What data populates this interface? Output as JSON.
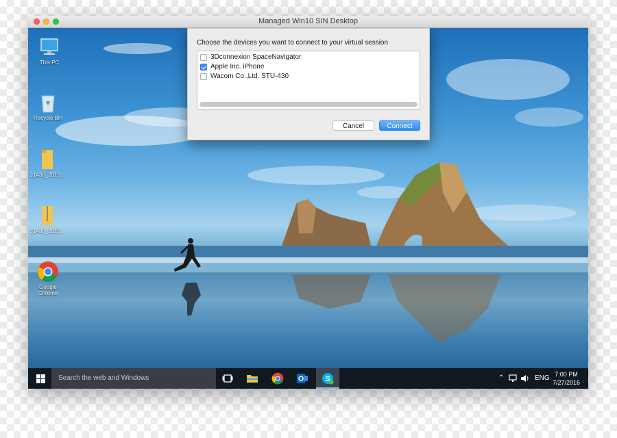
{
  "window": {
    "title": "Managed Win10 SIN Desktop",
    "traffic_colors": {
      "close": "#fc605b",
      "minimize": "#fdbc40",
      "maximize": "#34c84a"
    }
  },
  "desktop_icons": [
    {
      "label": "This PC",
      "icon": "computer-icon"
    },
    {
      "label": "Recycle Bin",
      "icon": "recycle-bin-icon"
    },
    {
      "label": "31430_2015...",
      "icon": "folder-icon"
    },
    {
      "label": "31430_2015...",
      "icon": "zip-folder-icon"
    },
    {
      "label": "Google Chrome",
      "icon": "chrome-icon"
    }
  ],
  "dialog": {
    "prompt": "Choose the devices you want to connect to your virtual session",
    "devices": [
      {
        "label": "3Dconnexion SpaceNavigator",
        "checked": false
      },
      {
        "label": "Apple Inc. iPhone",
        "checked": true
      },
      {
        "label": "Wacom Co.,Ltd. STU-430",
        "checked": false
      }
    ],
    "cancel_label": "Cancel",
    "connect_label": "Connect",
    "accent": "#2f8cf4"
  },
  "taskbar": {
    "search_placeholder": "Search the web and Windows",
    "pinned": [
      "task-view-icon",
      "file-explorer-icon",
      "chrome-icon",
      "outlook-icon",
      "skype-icon"
    ],
    "active_app": "skype-icon",
    "tray_lang": "ENG",
    "time": "7:00 PM",
    "date": "7/27/2016"
  }
}
